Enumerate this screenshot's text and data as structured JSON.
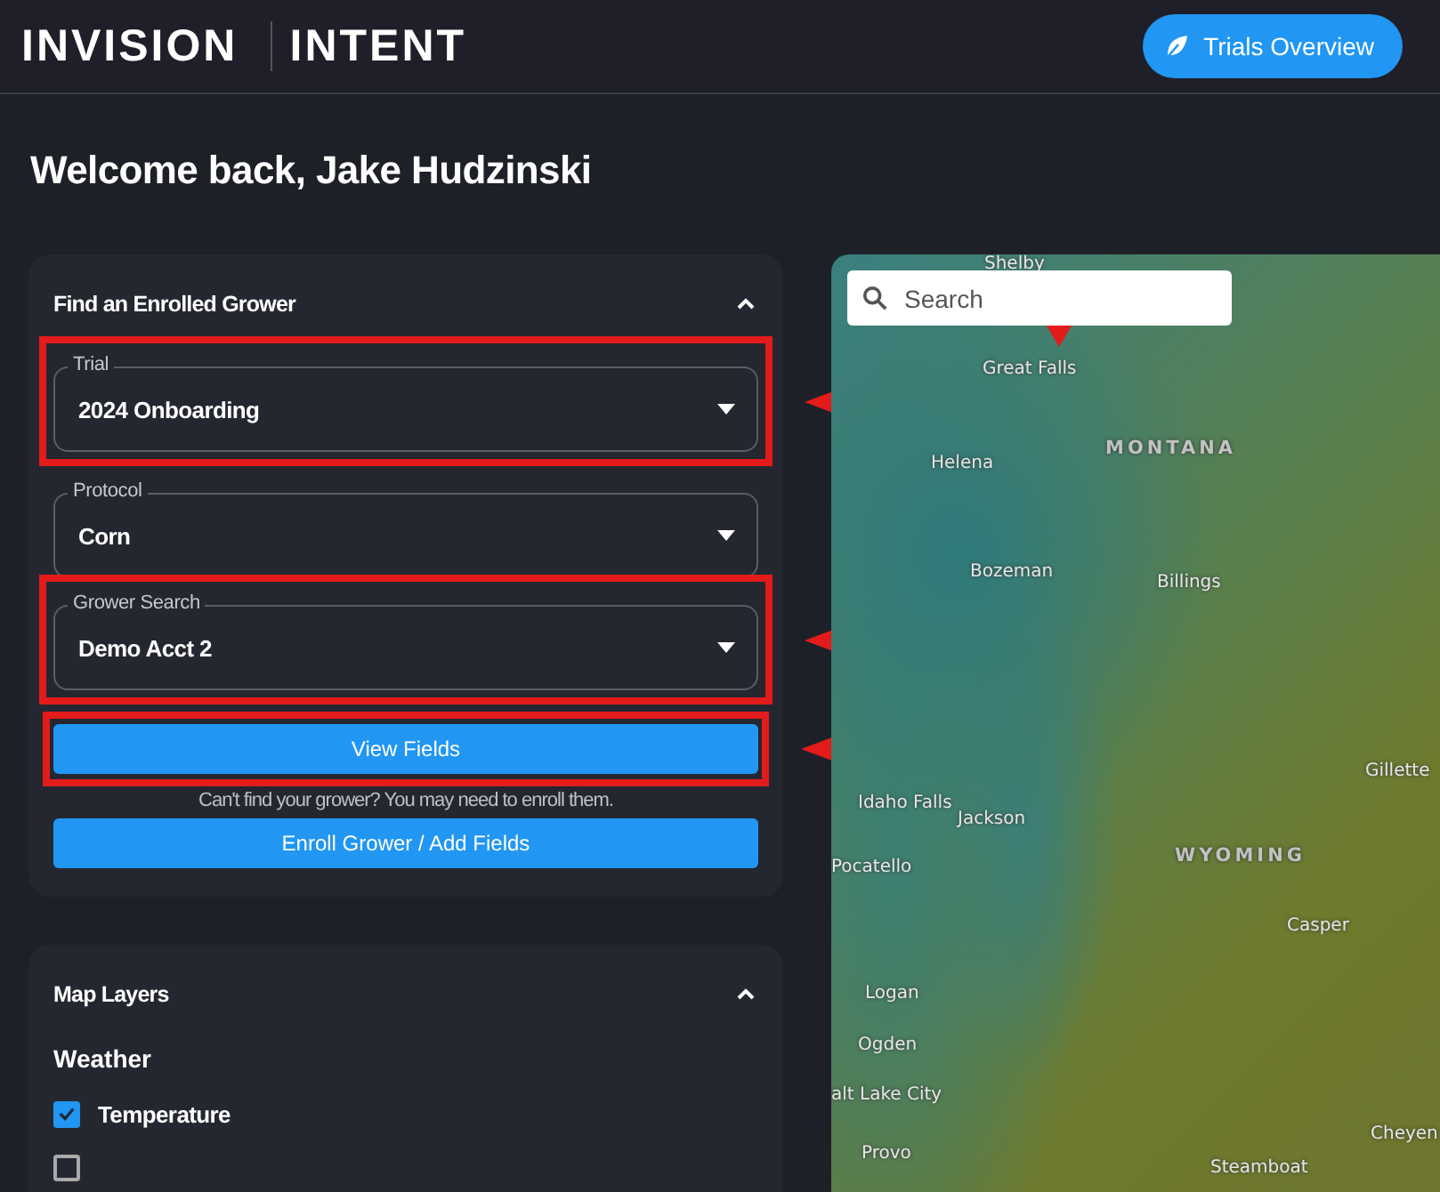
{
  "header": {
    "logo": "INVISION",
    "product": "INTENT",
    "nav_button": "Trials Overview"
  },
  "greeting": "Welcome back, Jake Hudzinski",
  "grower_panel": {
    "title": "Find an Enrolled Grower",
    "expanded": true,
    "fields": [
      {
        "label": "Trial",
        "value": "2024 Onboarding",
        "highlighted": true
      },
      {
        "label": "Protocol",
        "value": "Corn",
        "highlighted": false
      },
      {
        "label": "Grower Search",
        "value": "Demo Acct 2",
        "highlighted": true
      }
    ],
    "primary_button": {
      "label": "View Fields",
      "highlighted": true
    },
    "hint": "Can't find your grower? You may need to enroll them.",
    "secondary_button": {
      "label": "Enroll Grower / Add Fields"
    }
  },
  "layers_panel": {
    "title": "Map Layers",
    "expanded": true,
    "section": "Weather",
    "layers": [
      {
        "label": "Temperature",
        "checked": true
      },
      {
        "checked": false
      }
    ]
  },
  "map": {
    "search": {
      "placeholder": "Search"
    },
    "labels": [
      {
        "text": "Shelby",
        "kind": "city"
      },
      {
        "text": "Great Falls",
        "kind": "city"
      },
      {
        "text": "MONTANA",
        "kind": "state"
      },
      {
        "text": "Helena",
        "kind": "city"
      },
      {
        "text": "Bozeman",
        "kind": "city"
      },
      {
        "text": "Billings",
        "kind": "city"
      },
      {
        "text": "Idaho Falls",
        "kind": "city"
      },
      {
        "text": "Jackson",
        "kind": "city"
      },
      {
        "text": "Gillette",
        "kind": "city"
      },
      {
        "text": "Pocatello",
        "kind": "city"
      },
      {
        "text": "WYOMING",
        "kind": "state"
      },
      {
        "text": "Casper",
        "kind": "city"
      },
      {
        "text": "Logan",
        "kind": "city"
      },
      {
        "text": "Ogden",
        "kind": "city"
      },
      {
        "text": "alt Lake City",
        "kind": "city"
      },
      {
        "text": "Provo",
        "kind": "city"
      },
      {
        "text": "Steamboat",
        "kind": "city"
      },
      {
        "text": "Cheyen",
        "kind": "city"
      }
    ]
  }
}
